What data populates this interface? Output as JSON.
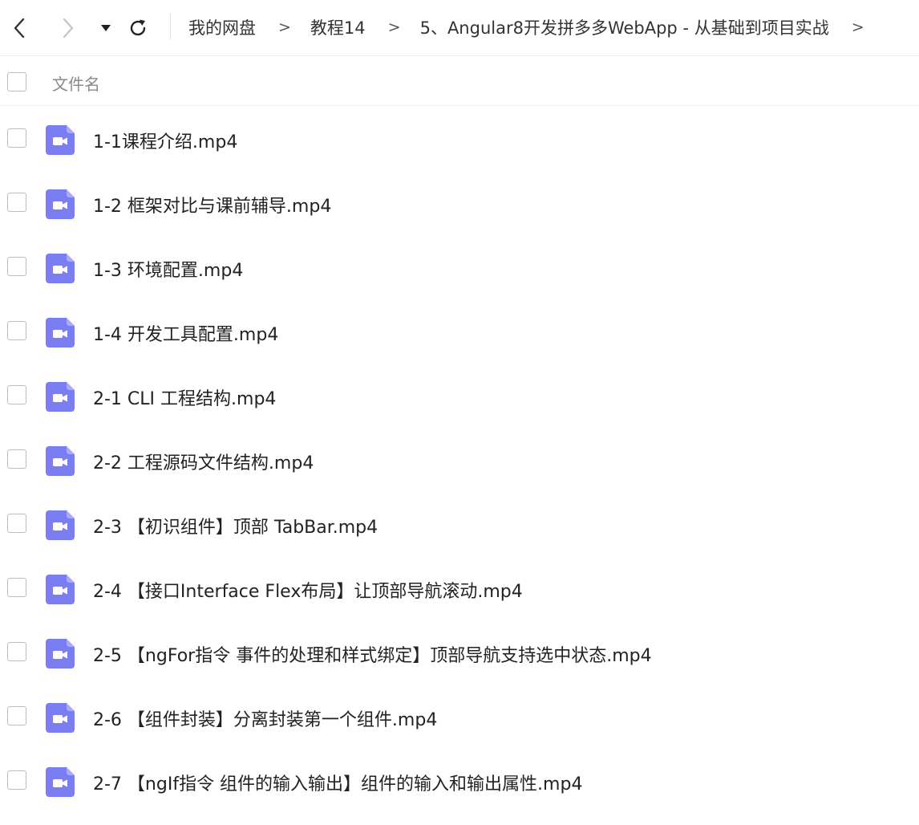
{
  "breadcrumb": [
    "我的网盘",
    "教程14",
    "5、Angular8开发拼多多WebApp - 从基础到项目实战"
  ],
  "breadcrumb_separator": ">",
  "header": {
    "column_name": "文件名"
  },
  "icon_color": "#7b7ef2",
  "files": [
    {
      "name": "1-1课程介绍.mp4",
      "icon": "video-file-icon"
    },
    {
      "name": "1-2 框架对比与课前辅导.mp4",
      "icon": "video-file-icon"
    },
    {
      "name": "1-3 环境配置.mp4",
      "icon": "video-file-icon"
    },
    {
      "name": "1-4 开发工具配置.mp4",
      "icon": "video-file-icon"
    },
    {
      "name": "2-1 CLI 工程结构.mp4",
      "icon": "video-file-icon"
    },
    {
      "name": "2-2 工程源码文件结构.mp4",
      "icon": "video-file-icon"
    },
    {
      "name": "2-3 【初识组件】顶部 TabBar.mp4",
      "icon": "video-file-icon"
    },
    {
      "name": "2-4 【接口Interface Flex布局】让顶部导航滚动.mp4",
      "icon": "video-file-icon"
    },
    {
      "name": "2-5 【ngFor指令 事件的处理和样式绑定】顶部导航支持选中状态.mp4",
      "icon": "video-file-icon"
    },
    {
      "name": "2-6 【组件封装】分离封装第一个组件.mp4",
      "icon": "video-file-icon"
    },
    {
      "name": "2-7 【ngIf指令 组件的输入输出】组件的输入和输出属性.mp4",
      "icon": "video-file-icon"
    }
  ]
}
